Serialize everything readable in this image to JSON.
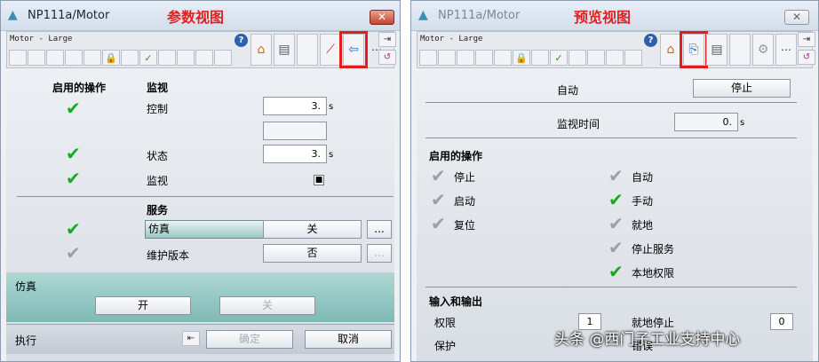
{
  "left_window": {
    "title": "NP111a/Motor",
    "annotation": "参数视图",
    "close_label": "✕",
    "faceplate_label": "Motor - Large",
    "help_label": "?",
    "enabled_ops_header": "启用的操作",
    "monitor_header": "监视",
    "control_label": "控制",
    "control_value": "3.",
    "control_unit": "s",
    "status_label": "状态",
    "status_value": "3.",
    "status_unit": "s",
    "monitor_label": "监视",
    "monitor_checked": "■",
    "service_header": "服务",
    "simulation_label": "仿真",
    "simulation_value": "关",
    "maintenance_label": "维护版本",
    "maintenance_value": "否",
    "more_label": "...",
    "sim_panel_title": "仿真",
    "on_button": "开",
    "off_button": "关",
    "exec_label": "执行",
    "confirm_button": "确定",
    "cancel_button": "取消"
  },
  "right_window": {
    "title": "NP111a/Motor",
    "annotation": "预览视图",
    "close_label": "✕",
    "faceplate_label": "Motor - Large",
    "help_label": "?",
    "auto_label": "自动",
    "stop_button": "停止",
    "monitor_time_label": "监视时间",
    "monitor_time_value": "0.",
    "monitor_time_unit": "s",
    "enabled_ops_header": "启用的操作",
    "ops_left": [
      {
        "label": "停止",
        "enabled": false
      },
      {
        "label": "启动",
        "enabled": false
      },
      {
        "label": "复位",
        "enabled": false
      }
    ],
    "ops_right": [
      {
        "label": "自动",
        "enabled": false
      },
      {
        "label": "手动",
        "enabled": true
      },
      {
        "label": "就地",
        "enabled": false
      },
      {
        "label": "停止服务",
        "enabled": false
      },
      {
        "label": "本地权限",
        "enabled": true
      }
    ],
    "io_header": "输入和输出",
    "permission_label": "权限",
    "permission_value": "1",
    "protection_label": "保护",
    "local_stop_label": "就地停止",
    "local_stop_value": "0",
    "fault_label": "错误"
  },
  "watermark": "头条 @西门子工业支持中心",
  "icons": {
    "faceplate_logo": "faceplate-logo-icon",
    "lock": "lock-icon",
    "check": "check-icon",
    "house": "standard-view-icon",
    "doc": "message-view-icon",
    "trend": "trend-view-icon",
    "parameter": "parameter-view-icon",
    "preview": "preview-view-icon",
    "undo": "undo-icon"
  },
  "colors": {
    "annotation_red": "#e02020",
    "check_green": "#18a91c",
    "check_gray": "#9aa0a8",
    "sim_panel_teal": "#8fc7c2"
  }
}
